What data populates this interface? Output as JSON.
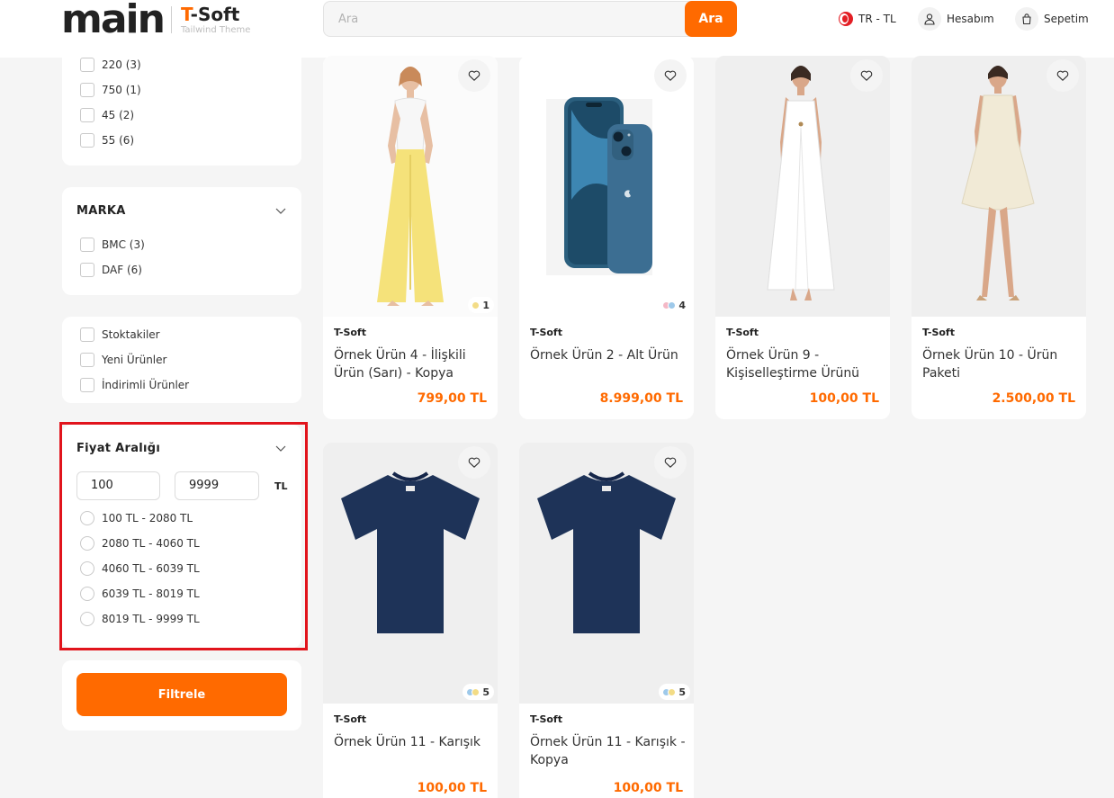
{
  "header": {
    "logo_main": "main",
    "logo_brand_t": "T",
    "logo_brand_rest": "-Soft",
    "logo_sub": "Tailwind Theme",
    "search_placeholder": "Ara",
    "search_button": "Ara",
    "lang_currency": "TR - TL",
    "account_label": "Hesabım",
    "cart_label": "Sepetim",
    "accent_color": "#ff6a00"
  },
  "sidebar": {
    "size_options": [
      "220 (3)",
      "750 (1)",
      "45 (2)",
      "55 (6)"
    ],
    "brand_title": "MARKA",
    "brand_options": [
      "BMC (3)",
      "DAF (6)"
    ],
    "stock_options": [
      "Stoktakiler",
      "Yeni Ürünler",
      "İndirimli Ürünler"
    ],
    "price_title": "Fiyat Aralığı",
    "price_min": "100",
    "price_max": "9999",
    "price_currency": "TL",
    "price_ranges": [
      "100 TL - 2080 TL",
      "2080 TL - 4060 TL",
      "4060 TL - 6039 TL",
      "6039 TL - 8019 TL",
      "8019 TL - 9999 TL"
    ],
    "filter_button": "Filtrele"
  },
  "products": [
    {
      "brand": "T-Soft",
      "name": "Örnek Ürün 4 - İlişkili Ürün (Sarı) - Kopya",
      "price": "799,00 TL",
      "variants": "1",
      "image": "yellow-pants-model"
    },
    {
      "brand": "T-Soft",
      "name": "Örnek Ürün 2 - Alt Ürün",
      "price": "8.999,00 TL",
      "variants": "4",
      "image": "blue-smartphone"
    },
    {
      "brand": "T-Soft",
      "name": "Örnek Ürün 9 - Kişiselleştirme Ürünü",
      "price": "100,00 TL",
      "variants": "",
      "image": "white-dress-model"
    },
    {
      "brand": "T-Soft",
      "name": "Örnek Ürün 10 - Ürün Paketi",
      "price": "2.500,00 TL",
      "variants": "",
      "image": "cream-dress-model"
    },
    {
      "brand": "T-Soft",
      "name": "Örnek Ürün 11 - Karışık",
      "price": "100,00 TL",
      "variants": "5",
      "image": "navy-tshirt"
    },
    {
      "brand": "T-Soft",
      "name": "Örnek Ürün 11 - Karışık - Kopya",
      "price": "100,00 TL",
      "variants": "5",
      "image": "navy-tshirt"
    }
  ]
}
